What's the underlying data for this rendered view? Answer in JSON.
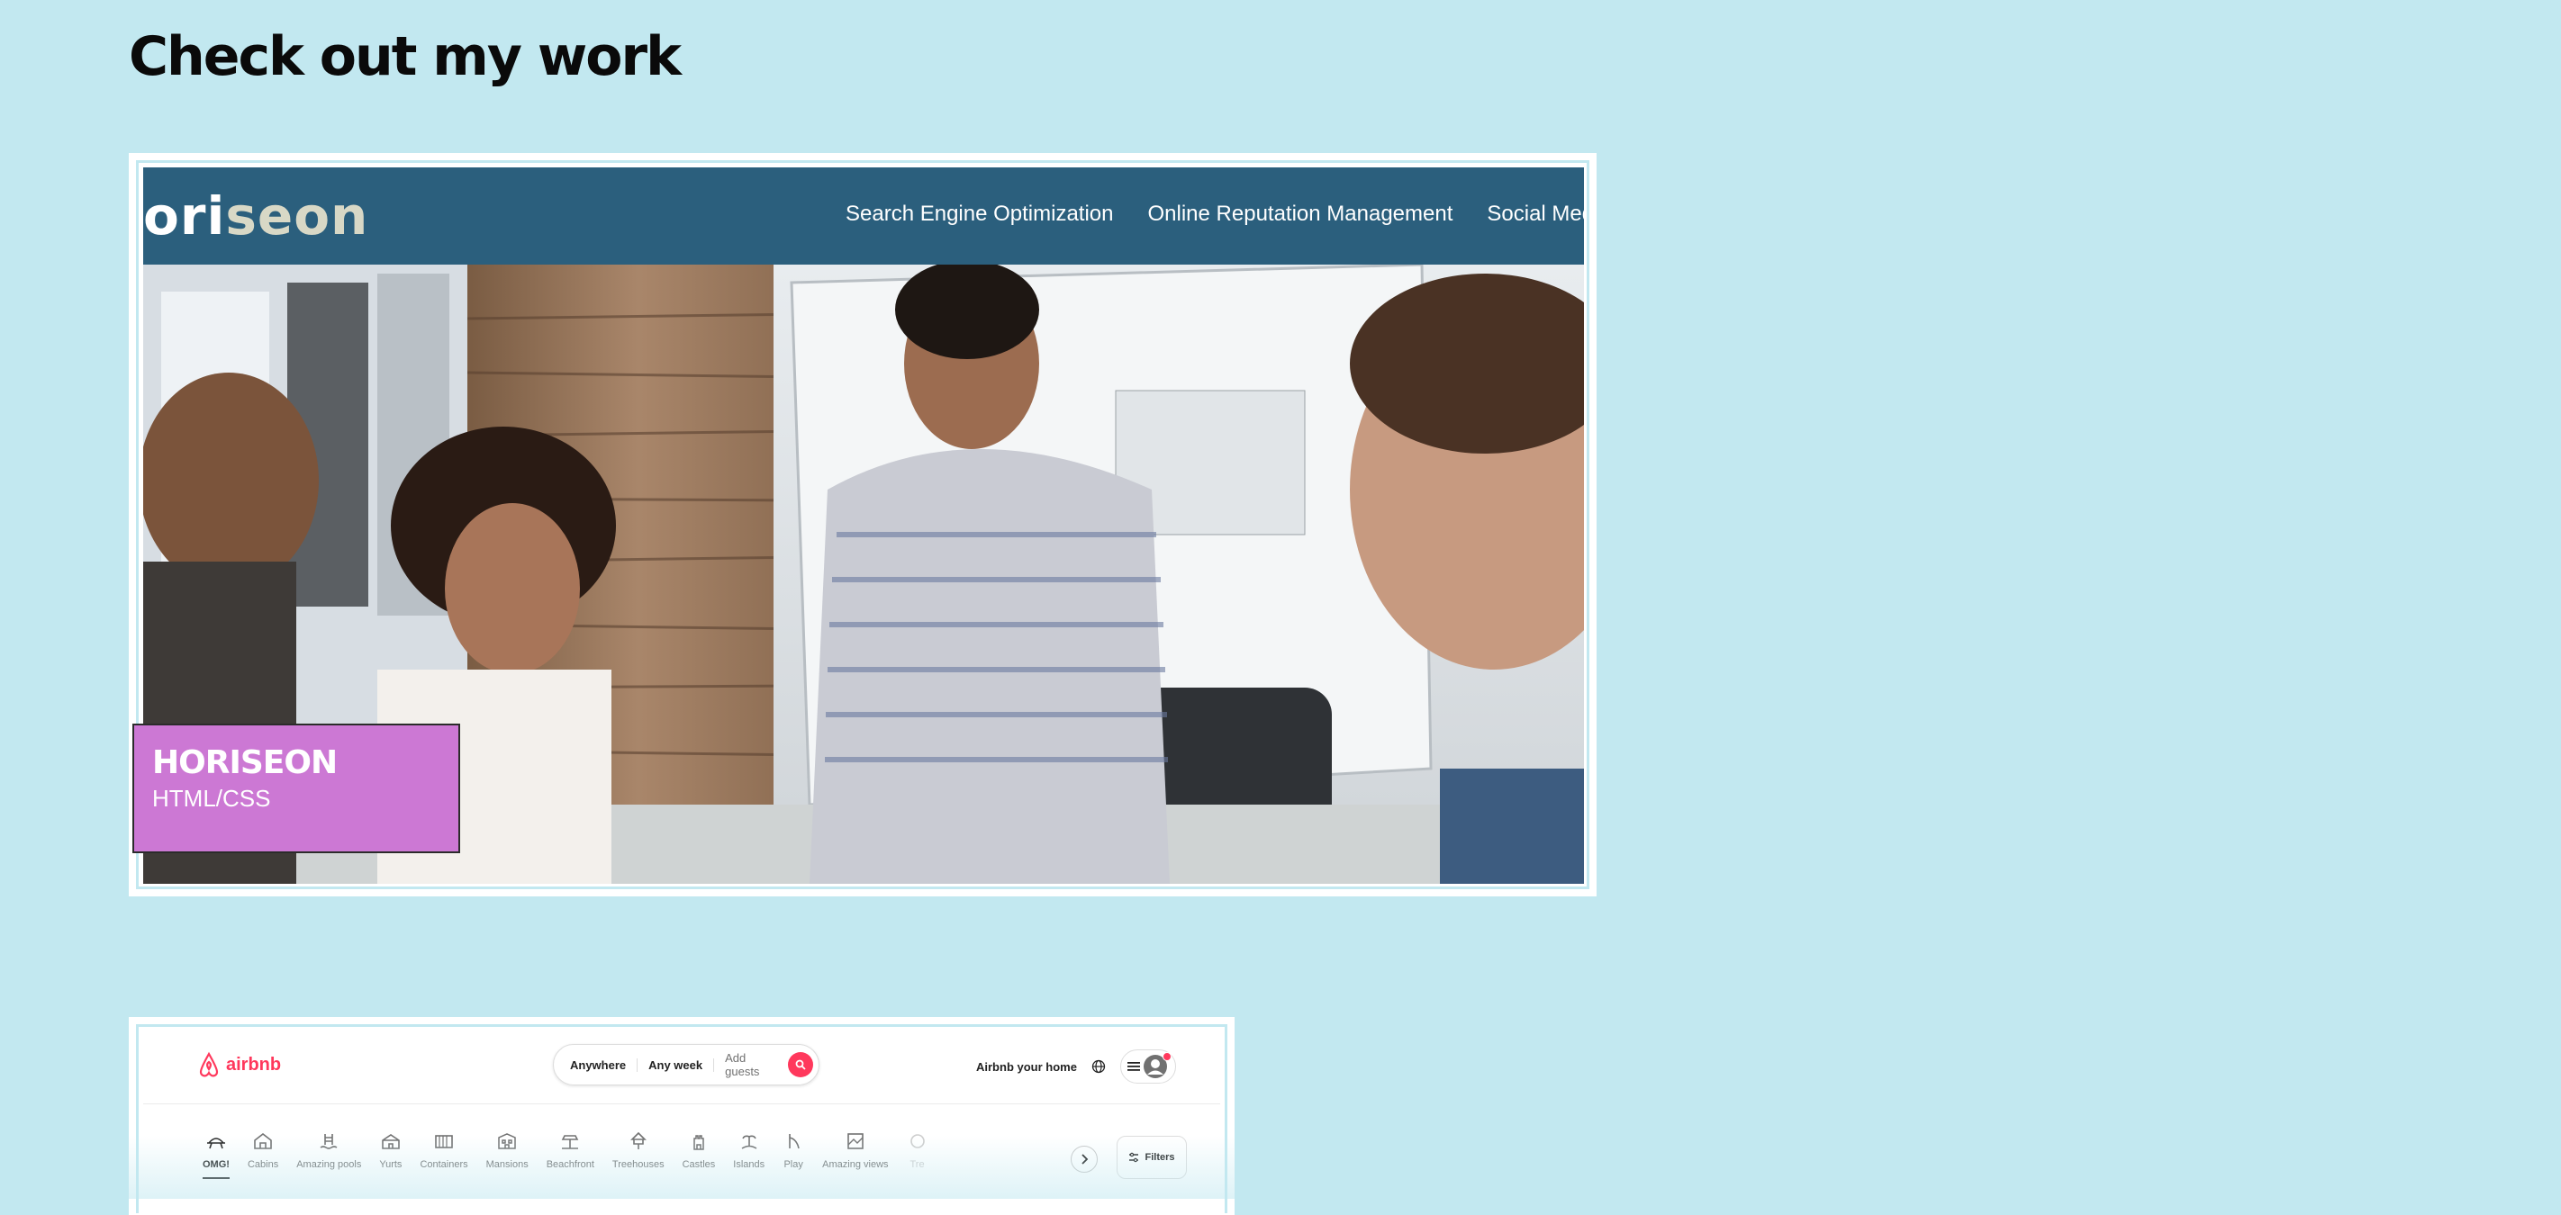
{
  "section": {
    "title": "Check out my work"
  },
  "projects": [
    {
      "name": "HORISEON",
      "tech": "HTML/CSS",
      "screenshot": {
        "logo_prefix": "ori",
        "logo_accent": "seon",
        "nav": [
          "Search Engine Optimization",
          "Online Reputation Management",
          "Social Media M"
        ]
      }
    },
    {
      "screenshot": {
        "logo": "airbnb",
        "search": {
          "where": "Anywhere",
          "when": "Any week",
          "guests": "Add guests"
        },
        "host_link": "Airbnb your home",
        "categories": [
          "OMG!",
          "Cabins",
          "Amazing pools",
          "Yurts",
          "Containers",
          "Mansions",
          "Beachfront",
          "Treehouses",
          "Castles",
          "Islands",
          "Play",
          "Amazing views",
          "Tre"
        ],
        "filters": "Filters"
      }
    }
  ],
  "colors": {
    "page_bg": "#c2e8f0",
    "horiseon_header": "#2b5f7d",
    "label_bg": "#cc78d4",
    "airbnb_brand": "#ff385c"
  }
}
